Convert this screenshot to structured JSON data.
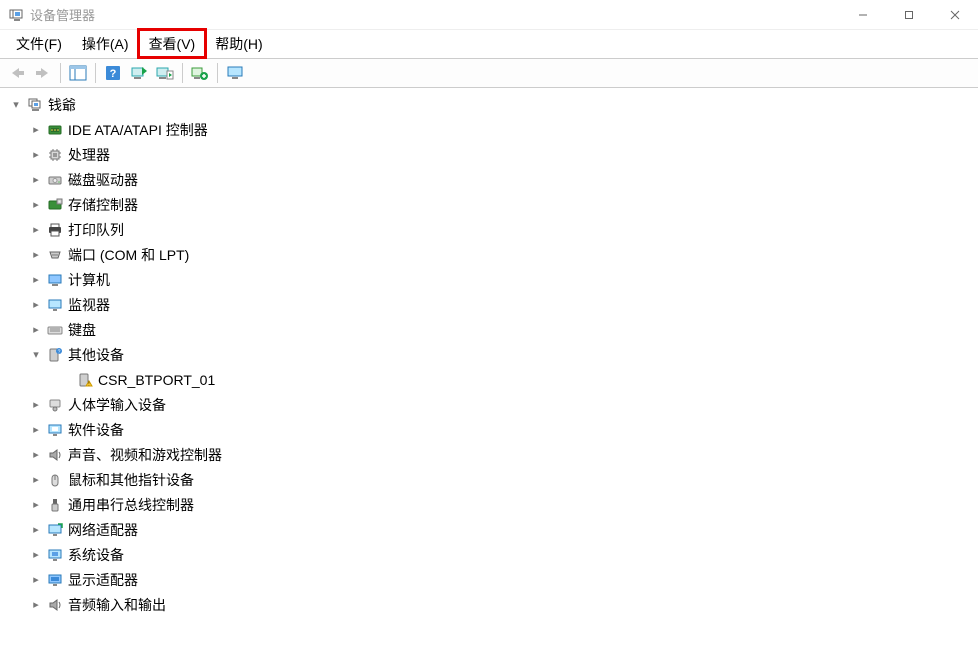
{
  "window": {
    "title": "设备管理器",
    "controls": {
      "minimize": "–",
      "maximize": "□",
      "close": "×"
    }
  },
  "menu": {
    "file": "文件(F)",
    "action": "操作(A)",
    "view": "查看(V)",
    "help": "帮助(H)",
    "highlighted": "view"
  },
  "toolbar": {
    "back": "back-arrow",
    "forward": "forward-arrow",
    "details": "details-view",
    "help": "help",
    "scan": "scan-hardware",
    "scan2": "scan-hardware-play",
    "refresh": "refresh-devices",
    "monitor": "monitor"
  },
  "tree": {
    "root": {
      "label": "钱爺",
      "icon": "computer-root",
      "expanded": true
    },
    "children": [
      {
        "icon": "ide",
        "label": "IDE ATA/ATAPI 控制器",
        "expanded": false
      },
      {
        "icon": "cpu",
        "label": "处理器",
        "expanded": false
      },
      {
        "icon": "disk",
        "label": "磁盘驱动器",
        "expanded": false
      },
      {
        "icon": "storage",
        "label": "存储控制器",
        "expanded": false
      },
      {
        "icon": "printer",
        "label": "打印队列",
        "expanded": false
      },
      {
        "icon": "port",
        "label": "端口 (COM 和 LPT)",
        "expanded": false
      },
      {
        "icon": "pc",
        "label": "计算机",
        "expanded": false
      },
      {
        "icon": "monitor",
        "label": "监视器",
        "expanded": false
      },
      {
        "icon": "keyboard",
        "label": "键盘",
        "expanded": false
      },
      {
        "icon": "other",
        "label": "其他设备",
        "expanded": true,
        "children": [
          {
            "icon": "unknown",
            "label": "CSR_BTPORT_01"
          }
        ]
      },
      {
        "icon": "hid",
        "label": "人体学输入设备",
        "expanded": false
      },
      {
        "icon": "software",
        "label": "软件设备",
        "expanded": false
      },
      {
        "icon": "audio",
        "label": "声音、视频和游戏控制器",
        "expanded": false
      },
      {
        "icon": "mouse",
        "label": "鼠标和其他指针设备",
        "expanded": false
      },
      {
        "icon": "usb",
        "label": "通用串行总线控制器",
        "expanded": false
      },
      {
        "icon": "network",
        "label": "网络适配器",
        "expanded": false
      },
      {
        "icon": "system",
        "label": "系统设备",
        "expanded": false
      },
      {
        "icon": "display",
        "label": "显示适配器",
        "expanded": false
      },
      {
        "icon": "audioio",
        "label": "音频输入和输出",
        "expanded": false
      }
    ]
  }
}
